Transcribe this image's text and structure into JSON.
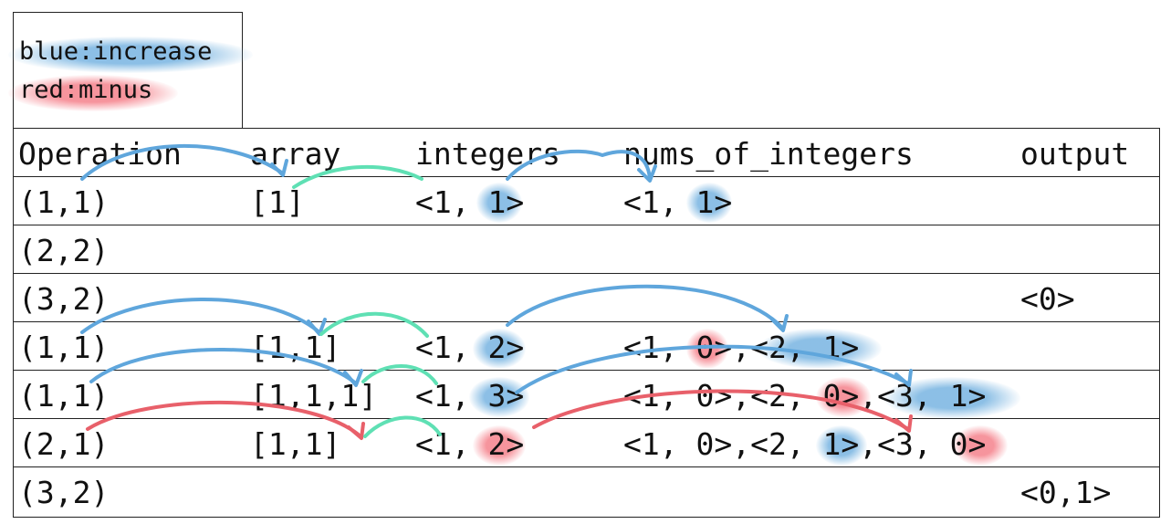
{
  "legend": {
    "blue": "blue:increase",
    "red": "red:minus"
  },
  "headers": [
    "Operation",
    "array",
    "integers",
    "nums_of_integers",
    "output"
  ],
  "rows": [
    {
      "operation": "(1,1)",
      "array": "[1]",
      "integers": "<1, 1>",
      "nums": "<1, 1>",
      "output": ""
    },
    {
      "operation": "(2,2)",
      "array": "",
      "integers": "",
      "nums": "",
      "output": ""
    },
    {
      "operation": "(3,2)",
      "array": "",
      "integers": "",
      "nums": "",
      "output": "<0>"
    },
    {
      "operation": "(1,1)",
      "array": "[1,1]",
      "integers": "<1, 2>",
      "nums": "<1, 0>,<2, 1>",
      "output": ""
    },
    {
      "operation": "(1,1)",
      "array": "[1,1,1]",
      "integers": "<1, 3>",
      "nums": "<1, 0>,<2, 0>,<3, 1>",
      "output": ""
    },
    {
      "operation": "(2,1)",
      "array": "[1,1]",
      "integers": "<1, 2>",
      "nums": "<1, 0>,<2, 1>,<3, 0>",
      "output": ""
    },
    {
      "operation": "(3,2)",
      "array": "",
      "integers": "",
      "nums": "",
      "output": "<0,1>"
    }
  ],
  "colors": {
    "blue_highlight": "#78b4e1",
    "red_highlight": "#f5828c",
    "blue_arrow": "#5fa6dc",
    "green_arrow": "#5fe0b4",
    "red_arrow": "#e8606a"
  }
}
